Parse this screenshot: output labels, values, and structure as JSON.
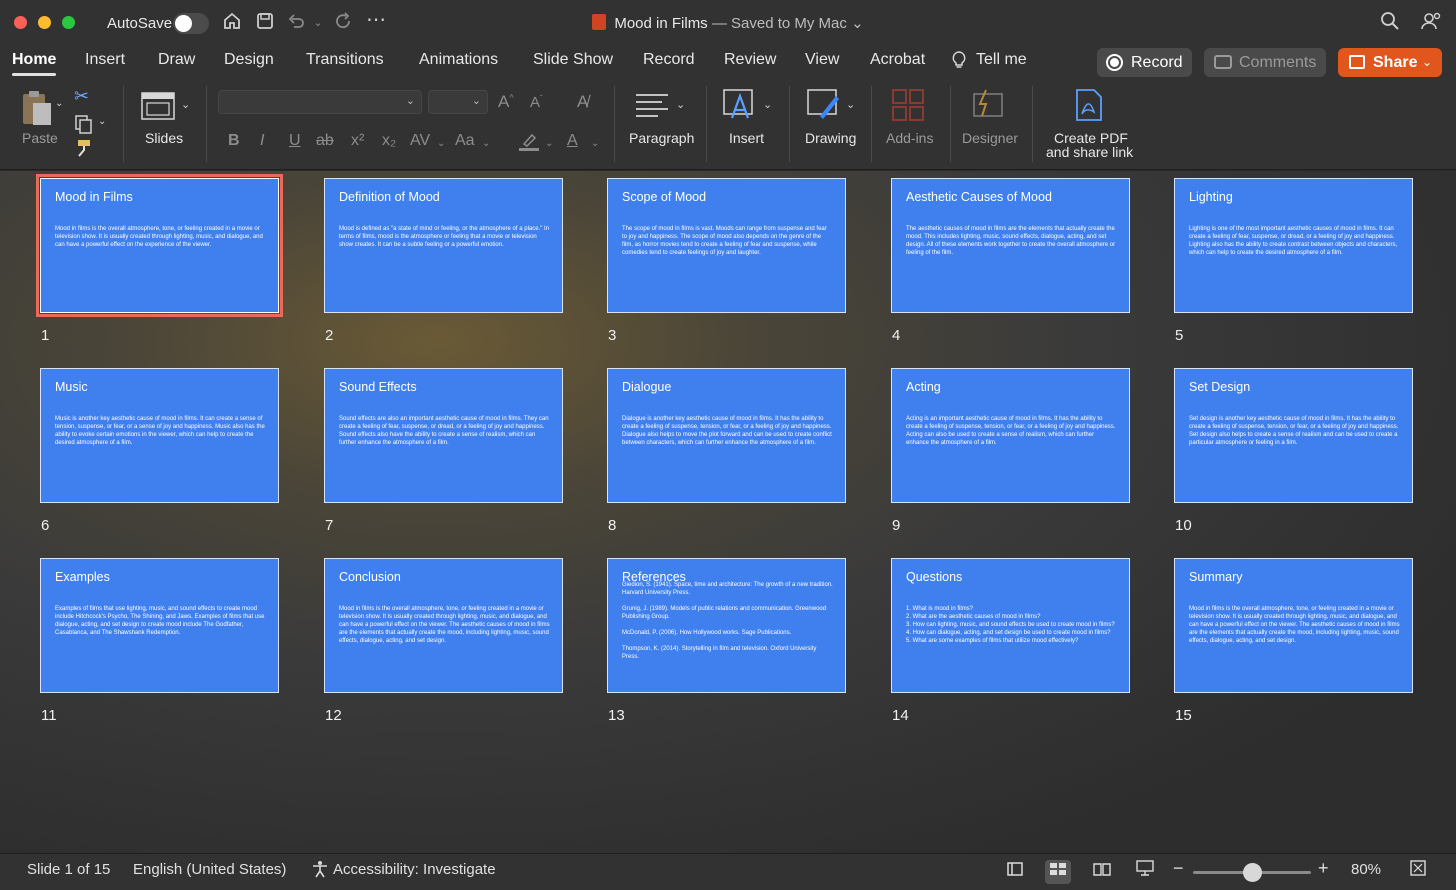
{
  "titlebar": {
    "autosave_label": "AutoSave",
    "doc_name": "Mood in Films",
    "saved_status": " — Saved to My Mac",
    "chevron": "⌄"
  },
  "tabs": [
    {
      "label": "Home",
      "active": true
    },
    {
      "label": "Insert"
    },
    {
      "label": "Draw"
    },
    {
      "label": "Design"
    },
    {
      "label": "Transitions"
    },
    {
      "label": "Animations"
    },
    {
      "label": "Slide Show"
    },
    {
      "label": "Record"
    },
    {
      "label": "Review"
    },
    {
      "label": "View"
    },
    {
      "label": "Acrobat"
    },
    {
      "label": "Tell me"
    }
  ],
  "buttons": {
    "record": "Record",
    "comments": "Comments",
    "share": "Share"
  },
  "ribbon": {
    "paste": "Paste",
    "slides": "Slides",
    "paragraph": "Paragraph",
    "insert": "Insert",
    "drawing": "Drawing",
    "addins": "Add-ins",
    "designer": "Designer",
    "create_pdf_line1": "Create PDF",
    "create_pdf_line2": "and share link",
    "font_buttons": [
      "B",
      "I",
      "U",
      "ab",
      "x²",
      "x₂",
      "AV",
      "Aa",
      "A"
    ]
  },
  "slides": [
    {
      "num": "1",
      "title": "Mood in Films",
      "body": "Mood in films is the overall atmosphere, tone, or feeling created in a movie or television show. It is usually created through lighting, music, and dialogue, and can have a powerful effect on the experience of the viewer.",
      "selected": true
    },
    {
      "num": "2",
      "title": "Definition of Mood",
      "body": "Mood is defined as \"a state of mind or feeling, or the atmosphere of a place.\" In terms of films, mood is the atmosphere or feeling that a movie or television show creates. It can be a subtle feeling or a powerful emotion."
    },
    {
      "num": "3",
      "title": "Scope of Mood",
      "body": "The scope of mood in films is vast. Moods can range from suspense and fear to joy and happiness. The scope of mood also depends on the genre of the film, as horror movies tend to create a feeling of fear and suspense, while comedies tend to create feelings of joy and laughter."
    },
    {
      "num": "4",
      "title": "Aesthetic Causes of Mood",
      "body": "The aesthetic causes of mood in films are the elements that actually create the mood. This includes lighting, music, sound effects, dialogue, acting, and set design. All of these elements work together to create the overall atmosphere or feeling of the film."
    },
    {
      "num": "5",
      "title": "Lighting",
      "body": "Lighting is one of the most important aesthetic causes of mood in films. It can create a feeling of fear, suspense, or dread, or a feeling of joy and happiness. Lighting also has the ability to create contrast between objects and characters, which can help to create the desired atmosphere of a film."
    },
    {
      "num": "6",
      "title": "Music",
      "body": "Music is another key aesthetic cause of mood in films. It can create a sense of tension, suspense, or fear, or a sense of joy and happiness. Music also has the ability to evoke certain emotions in the viewer, which can help to create the desired atmosphere of a film."
    },
    {
      "num": "7",
      "title": "Sound Effects",
      "body": "Sound effects are also an important aesthetic cause of mood in films. They can create a feeling of fear, suspense, or dread, or a feeling of joy and happiness. Sound effects also have the ability to create a sense of realism, which can further enhance the atmosphere of a film."
    },
    {
      "num": "8",
      "title": "Dialogue",
      "body": "Dialogue is another key aesthetic cause of mood in films. It has the ability to create a feeling of suspense, tension, or fear, or a feeling of joy and happiness. Dialogue also helps to move the plot forward and can be used to create conflict between characters, which can further enhance the atmosphere of a film."
    },
    {
      "num": "9",
      "title": "Acting",
      "body": "Acting is an important aesthetic cause of mood in films. It has the ability to create a feeling of suspense, tension, or fear, or a feeling of joy and happiness. Acting can also be used to create a sense of realism, which can further enhance the atmosphere of a film."
    },
    {
      "num": "10",
      "title": "Set Design",
      "body": "Set design is another key aesthetic cause of mood in films. It has the ability to create a feeling of suspense, tension, or fear, or a feeling of joy and happiness. Set design also helps to create a sense of realism and can be used to create a particular atmosphere or feeling in a film."
    },
    {
      "num": "11",
      "title": "Examples",
      "body": "Examples of films that use lighting, music, and sound effects to create mood include Hitchcock's Psycho, The Shining, and Jaws. Examples of films that use dialogue, acting, and set design to create mood include The Godfather, Casablanca, and The Shawshank Redemption."
    },
    {
      "num": "12",
      "title": "Conclusion",
      "body": "Mood in films is the overall atmosphere, tone, or feeling created in a movie or television show. It is usually created through lighting, music, and dialogue, and can have a powerful effect on the viewer. The aesthetic causes of mood in films are the elements that actually create the mood, including lighting, music, sound effects, dialogue, acting, and set design."
    },
    {
      "num": "13",
      "title": "References",
      "body": "Giedion, S. (1941). Space, time and architecture: The growth of a new tradition. Harvard University Press.\n\nGrunig, J. (1989). Models of public relations and communication. Greenwood Publishing Group.\n\nMcDonald, P. (2006). How Hollywood works. Sage Publications.\n\nThompson, K. (2014). Storytelling in film and television. Oxford University Press.",
      "refs": true
    },
    {
      "num": "14",
      "title": "Questions",
      "body": "1. What is mood in films?\n2. What are the aesthetic causes of mood in films?\n3. How can lighting, music, and sound effects be used to create mood in films?\n4. How can dialogue, acting, and set design be used to create mood in films?\n5. What are some examples of films that utilize mood effectively?",
      "list": true
    },
    {
      "num": "15",
      "title": "Summary",
      "body": "Mood in films is the overall atmosphere, tone, or feeling created in a movie or television show. It is usually created through lighting, music, and dialogue, and can have a powerful effect on the viewer. The aesthetic causes of mood in films are the elements that actually create the mood, including lighting, music, sound effects, dialogue, acting, and set design."
    }
  ],
  "status": {
    "slide_counter": "Slide 1 of 15",
    "language": "English (United States)",
    "accessibility": "Accessibility: Investigate",
    "zoom_minus": "−",
    "zoom_plus": "+",
    "zoom": "80%",
    "zoom_level": 0.5
  },
  "colors": {
    "slide_bg": "#3f80ee",
    "selected_outline": "#e96a58",
    "share_button": "#e0561d"
  }
}
